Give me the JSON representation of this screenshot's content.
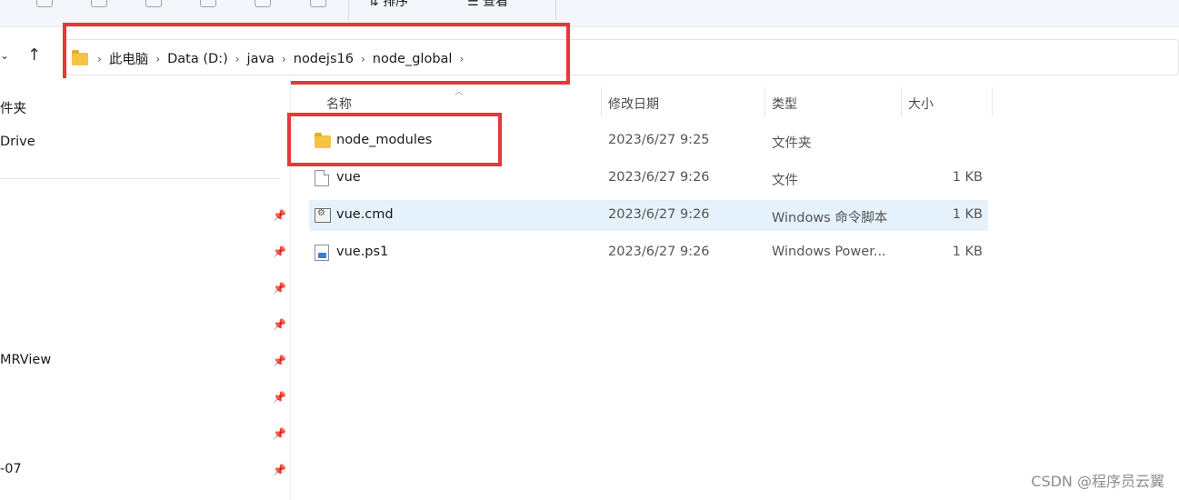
{
  "toolbar": {
    "sort_label": "排序",
    "view_label": "查看"
  },
  "breadcrumb": [
    "此电脑",
    "Data (D:)",
    "java",
    "nodejs16",
    "node_global"
  ],
  "sidebar": {
    "items": [
      "件夹",
      "Drive",
      "MRView",
      "-07"
    ]
  },
  "columns": {
    "name": "名称",
    "date": "修改日期",
    "type": "类型",
    "size": "大小"
  },
  "files": [
    {
      "name": "node_modules",
      "date": "2023/6/27 9:25",
      "type": "文件夹",
      "size": "",
      "icon": "folder-icon"
    },
    {
      "name": "vue",
      "date": "2023/6/27 9:26",
      "type": "文件",
      "size": "1 KB",
      "icon": "file-icon"
    },
    {
      "name": "vue.cmd",
      "date": "2023/6/27 9:26",
      "type": "Windows 命令脚本",
      "size": "1 KB",
      "icon": "cmd-script-icon"
    },
    {
      "name": "vue.ps1",
      "date": "2023/6/27 9:26",
      "type": "Windows Power...",
      "size": "1 KB",
      "icon": "powershell-script-icon"
    }
  ],
  "watermark": "CSDN @程序员云翼",
  "colors": {
    "highlight_box": "#e8363a",
    "selected_row": "#e5f1fb"
  }
}
